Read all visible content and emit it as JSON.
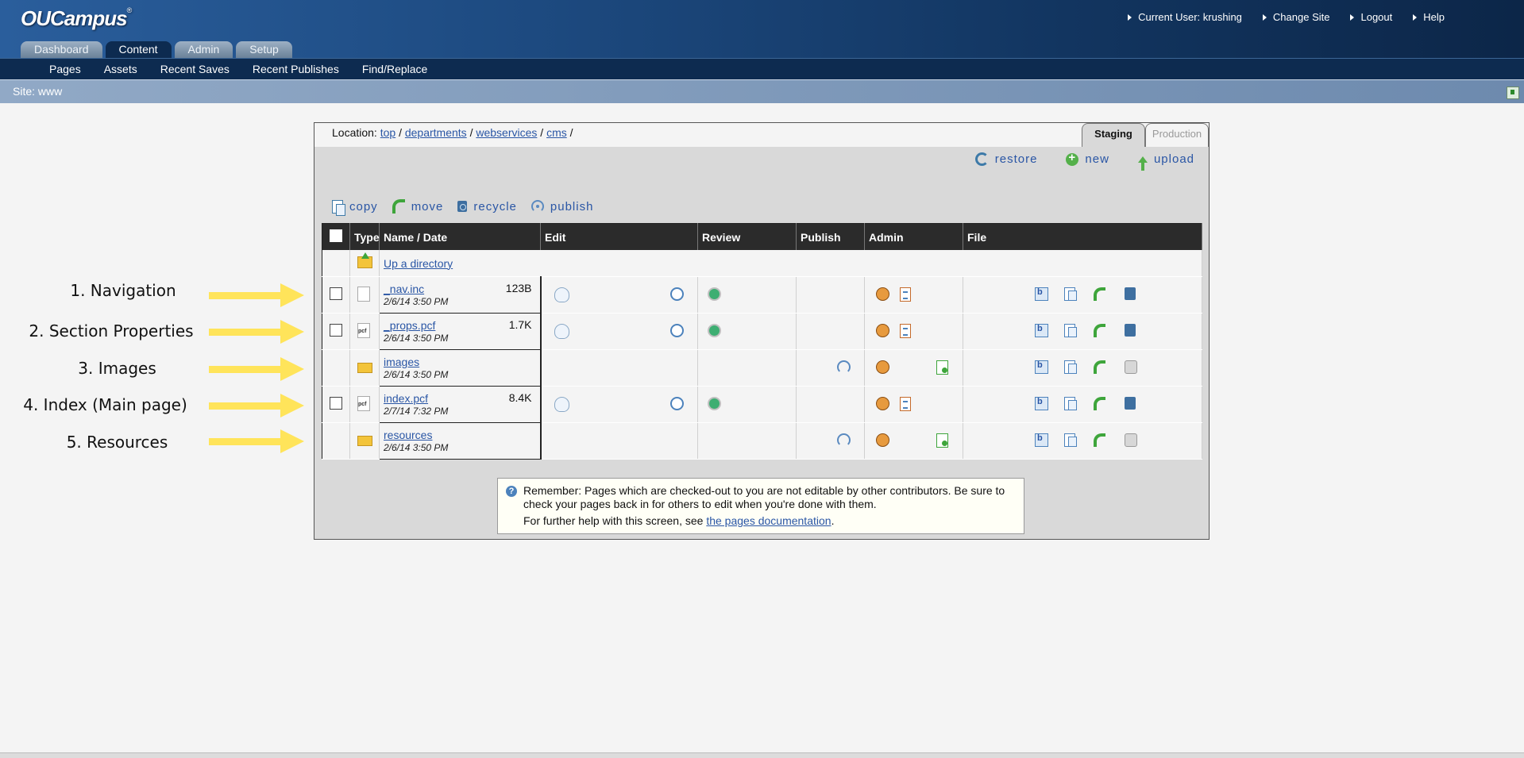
{
  "app": {
    "logo": "OUCampus",
    "logo_mark": "®",
    "user_links": [
      "Current User: krushing",
      "Change Site",
      "Logout",
      "Help"
    ],
    "main_tabs": [
      "Dashboard",
      "Content",
      "Admin",
      "Setup"
    ],
    "active_tab": "Content",
    "subnav": [
      "Pages",
      "Assets",
      "Recent Saves",
      "Recent Publishes",
      "Find/Replace"
    ],
    "site_label": "Site: www"
  },
  "annotations": [
    "1. Navigation",
    "2. Section Properties",
    "3. Images",
    "4. Index (Main page)",
    "5. Resources"
  ],
  "colors": {
    "annotation_arrow": "#ffe45a",
    "header_dark": "#0d2b50",
    "link": "#2a56a5"
  },
  "location": {
    "label": "Location:",
    "crumbs": [
      "top",
      "departments",
      "webservices",
      "cms"
    ]
  },
  "env_tabs": [
    "Staging",
    "Production"
  ],
  "top_actions": {
    "restore": "restore",
    "new": "new",
    "upload": "upload"
  },
  "bulk_actions": {
    "copy": "copy",
    "move": "move",
    "recycle": "recycle",
    "publish": "publish"
  },
  "table": {
    "headers": {
      "type": "Type",
      "name": "Name / Date",
      "edit": "Edit",
      "review": "Review",
      "publish": "Publish",
      "admin": "Admin",
      "file": "File"
    },
    "up_directory": "Up a directory",
    "rows": [
      {
        "name": "_nav.inc",
        "date": "2/6/14 3:50 PM",
        "size": "123B",
        "kind": "file"
      },
      {
        "name": "_props.pcf",
        "date": "2/6/14 3:50 PM",
        "size": "1.7K",
        "kind": "pcf"
      },
      {
        "name": "images",
        "date": "2/6/14 3:50 PM",
        "size": "",
        "kind": "folder"
      },
      {
        "name": "index.pcf",
        "date": "2/7/14 7:32 PM",
        "size": "8.4K",
        "kind": "pcf"
      },
      {
        "name": "resources",
        "date": "2/6/14 3:50 PM",
        "size": "",
        "kind": "folder"
      }
    ]
  },
  "notice": {
    "text": "Remember: Pages which are checked-out to you are not editable by other contributors. Be sure to check your pages back in for others to edit when you're done with them.",
    "help_prefix": "For further help with this screen, see ",
    "help_link": "the pages documentation",
    "help_suffix": "."
  },
  "icons": [
    "restore-icon",
    "new-icon",
    "upload-icon",
    "copy-icon",
    "move-icon",
    "recycle-icon",
    "publish-icon",
    "lightbulb-icon",
    "clock-icon",
    "review-icon",
    "admin-user-icon",
    "log-icon",
    "new-page-icon",
    "rename-icon",
    "locked-icon",
    "info-icon"
  ]
}
